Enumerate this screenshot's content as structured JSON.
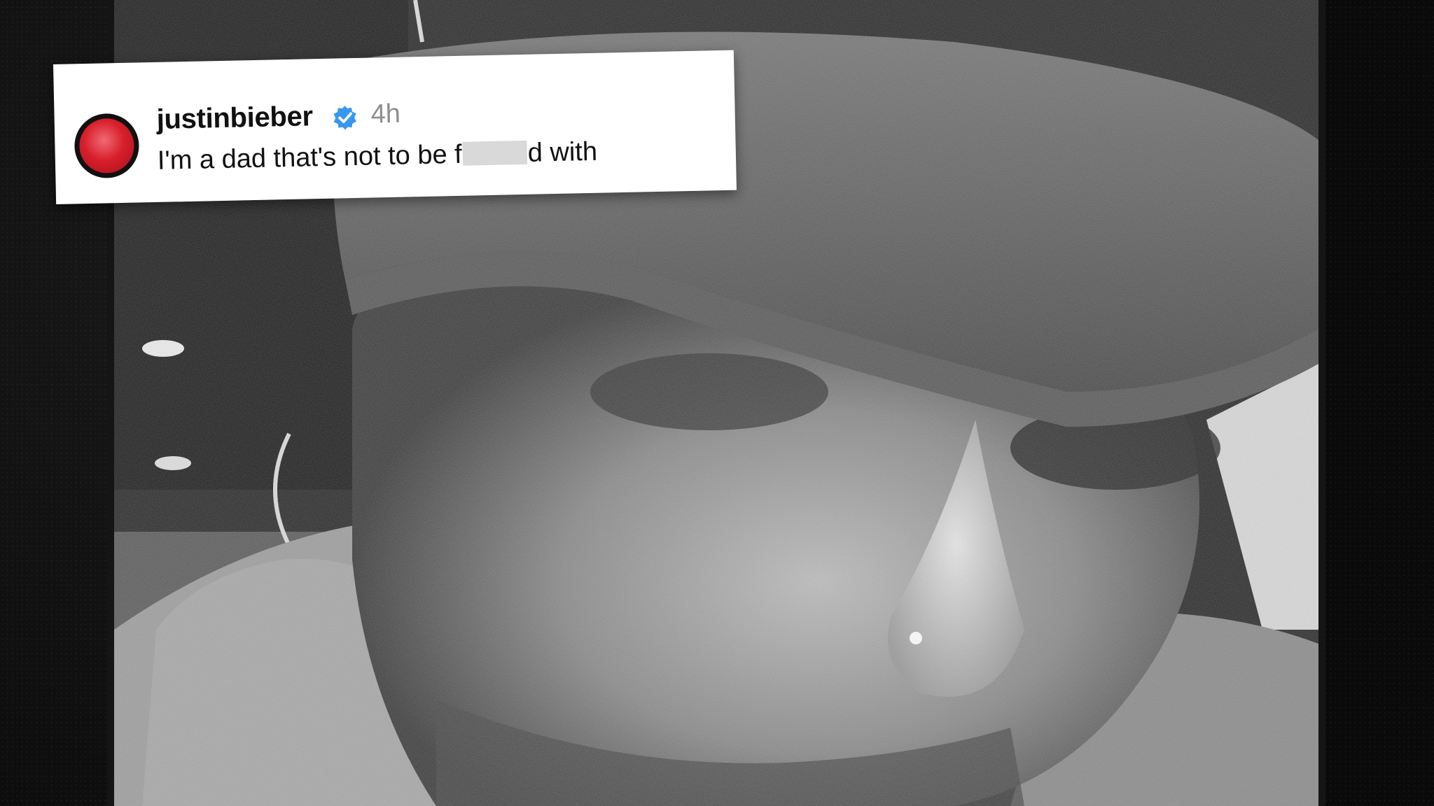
{
  "post": {
    "username": "justinbieber",
    "verified_icon": "verified-badge-icon",
    "timestamp": "4h",
    "caption_before": "I'm a dad that's not to be f",
    "caption_after": "d with",
    "avatar_color": "#d81f2c",
    "verified_color": "#3897f0"
  }
}
